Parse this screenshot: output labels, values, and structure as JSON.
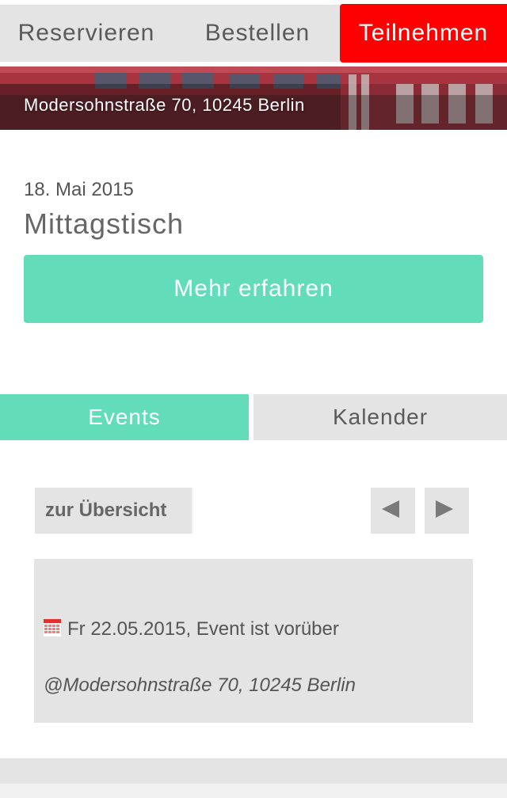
{
  "topnav": {
    "tabs": [
      {
        "label": "Reservieren"
      },
      {
        "label": "Bestellen"
      },
      {
        "label": "Teilnehmen"
      }
    ]
  },
  "hero": {
    "address": "Modersohnstraße 70, 10245 Berlin"
  },
  "event": {
    "date": "18. Mai 2015",
    "title": "Mittagstisch",
    "more_label": "Mehr erfahren"
  },
  "view_tabs": {
    "events_label": "Events",
    "calendar_label": "Kalender"
  },
  "pager": {
    "back_label": "zur Übersicht",
    "prev_icon": "triangle-left-icon",
    "next_icon": "triangle-right-icon"
  },
  "card": {
    "icon": "calendar-icon",
    "when": "Fr 22.05.2015, Event ist vorüber",
    "where": "@Modersohnstraße 70, 10245 Berlin"
  },
  "colors": {
    "accent_red": "#ff0000",
    "accent_mint": "#63dcb9",
    "panel_gray": "#e4e4e4"
  }
}
